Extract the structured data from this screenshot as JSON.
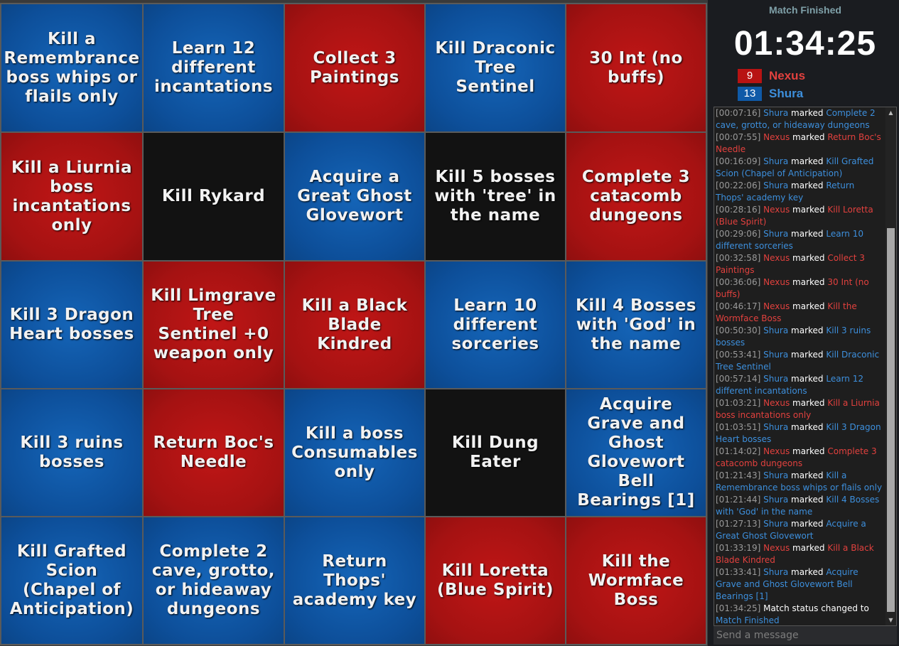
{
  "colors": {
    "blue": "#0d4f9a",
    "red": "#a51212",
    "black": "#121212"
  },
  "board": [
    {
      "text": "Kill a Remembrance boss whips or flails only",
      "color": "blue"
    },
    {
      "text": "Learn 12 different incantations",
      "color": "blue"
    },
    {
      "text": "Collect 3 Paintings",
      "color": "red"
    },
    {
      "text": "Kill Draconic Tree Sentinel",
      "color": "blue"
    },
    {
      "text": "30 Int (no buffs)",
      "color": "red"
    },
    {
      "text": "Kill a Liurnia boss incantations only",
      "color": "red"
    },
    {
      "text": "Kill Rykard",
      "color": "black"
    },
    {
      "text": "Acquire a Great Ghost Glovewort",
      "color": "blue"
    },
    {
      "text": "Kill 5 bosses with 'tree' in the name",
      "color": "black"
    },
    {
      "text": "Complete 3 catacomb dungeons",
      "color": "red"
    },
    {
      "text": "Kill 3 Dragon Heart bosses",
      "color": "blue"
    },
    {
      "text": "Kill Limgrave Tree Sentinel +0 weapon only",
      "color": "red"
    },
    {
      "text": "Kill a Black Blade Kindred",
      "color": "red"
    },
    {
      "text": "Learn 10 different sorceries",
      "color": "blue"
    },
    {
      "text": "Kill 4 Bosses with 'God' in the name",
      "color": "blue"
    },
    {
      "text": "Kill 3 ruins bosses",
      "color": "blue"
    },
    {
      "text": "Return Boc's Needle",
      "color": "red"
    },
    {
      "text": "Kill a boss Consumables only",
      "color": "blue"
    },
    {
      "text": "Kill Dung Eater",
      "color": "black"
    },
    {
      "text": "Acquire Grave and Ghost Glovewort Bell Bearings [1]",
      "color": "blue"
    },
    {
      "text": "Kill Grafted Scion (Chapel of Anticipation)",
      "color": "blue"
    },
    {
      "text": "Complete 2 cave, grotto, or hideaway dungeons",
      "color": "blue"
    },
    {
      "text": "Return Thops' academy key",
      "color": "blue"
    },
    {
      "text": "Kill Loretta (Blue Spirit)",
      "color": "red"
    },
    {
      "text": "Kill the Wormface Boss",
      "color": "red"
    }
  ],
  "sidebar": {
    "status": "Match Finished",
    "timer": "01:34:25",
    "players": [
      {
        "score": "9",
        "name": "Nexus",
        "color": "#e2413e",
        "box": "#b81313"
      },
      {
        "score": "13",
        "name": "Shura",
        "color": "#3d8fdc",
        "box": "#0f5aa8"
      }
    ],
    "message_placeholder": "Send a message"
  },
  "log": [
    {
      "time": "[00:07:16]",
      "who": "Shura",
      "team": "blue",
      "verb": "marked",
      "obj": "Complete 2 cave, grotto, or hideaway dungeons"
    },
    {
      "time": "[00:07:55]",
      "who": "Nexus",
      "team": "red",
      "verb": "marked",
      "obj": "Return Boc's Needle"
    },
    {
      "time": "[00:16:09]",
      "who": "Shura",
      "team": "blue",
      "verb": "marked",
      "obj": "Kill Grafted Scion (Chapel of Anticipation)"
    },
    {
      "time": "[00:22:06]",
      "who": "Shura",
      "team": "blue",
      "verb": "marked",
      "obj": "Return Thops' academy key"
    },
    {
      "time": "[00:28:16]",
      "who": "Nexus",
      "team": "red",
      "verb": "marked",
      "obj": "Kill Loretta (Blue Spirit)"
    },
    {
      "time": "[00:29:06]",
      "who": "Shura",
      "team": "blue",
      "verb": "marked",
      "obj": "Learn 10 different sorceries"
    },
    {
      "time": "[00:32:58]",
      "who": "Nexus",
      "team": "red",
      "verb": "marked",
      "obj": "Collect 3 Paintings"
    },
    {
      "time": "[00:36:06]",
      "who": "Nexus",
      "team": "red",
      "verb": "marked",
      "obj": "30 Int (no buffs)"
    },
    {
      "time": "[00:46:17]",
      "who": "Nexus",
      "team": "red",
      "verb": "marked",
      "obj": "Kill the Wormface Boss"
    },
    {
      "time": "[00:50:30]",
      "who": "Shura",
      "team": "blue",
      "verb": "marked",
      "obj": "Kill 3 ruins bosses"
    },
    {
      "time": "[00:53:41]",
      "who": "Shura",
      "team": "blue",
      "verb": "marked",
      "obj": "Kill Draconic Tree Sentinel"
    },
    {
      "time": "[00:57:14]",
      "who": "Shura",
      "team": "blue",
      "verb": "marked",
      "obj": "Learn 12 different incantations"
    },
    {
      "time": "[01:03:21]",
      "who": "Nexus",
      "team": "red",
      "verb": "marked",
      "obj": "Kill a Liurnia boss incantations only"
    },
    {
      "time": "[01:03:51]",
      "who": "Shura",
      "team": "blue",
      "verb": "marked",
      "obj": "Kill 3 Dragon Heart bosses"
    },
    {
      "time": "[01:14:02]",
      "who": "Nexus",
      "team": "red",
      "verb": "marked",
      "obj": "Complete 3 catacomb dungeons"
    },
    {
      "time": "[01:21:43]",
      "who": "Shura",
      "team": "blue",
      "verb": "marked",
      "obj": "Kill a Remembrance boss whips or flails only"
    },
    {
      "time": "[01:21:44]",
      "who": "Shura",
      "team": "blue",
      "verb": "marked",
      "obj": "Kill 4 Bosses with 'God' in the name"
    },
    {
      "time": "[01:27:13]",
      "who": "Shura",
      "team": "blue",
      "verb": "marked",
      "obj": "Acquire a Great Ghost Glovewort"
    },
    {
      "time": "[01:33:19]",
      "who": "Nexus",
      "team": "red",
      "verb": "marked",
      "obj": "Kill a Black Blade Kindred"
    },
    {
      "time": "[01:33:41]",
      "who": "Shura",
      "team": "blue",
      "verb": "marked",
      "obj": "Acquire Grave and Ghost Glovewort Bell Bearings [1]"
    },
    {
      "time": "[01:34:25]",
      "who": "",
      "team": "",
      "verb": "Match status changed to",
      "obj": "Match Finished"
    }
  ]
}
